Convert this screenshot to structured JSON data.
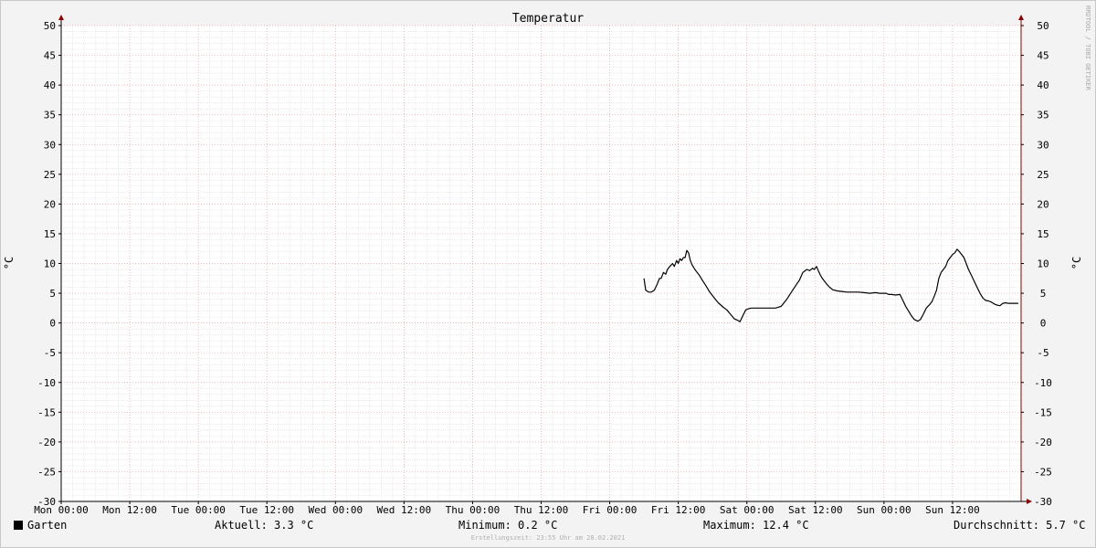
{
  "chart_data": {
    "type": "line",
    "title": "Temperatur",
    "ylabel": "°C",
    "ylim": [
      -30,
      50
    ],
    "y_ticks": [
      "50",
      "45",
      "40",
      "35",
      "30",
      "25",
      "20",
      "15",
      "10",
      "5",
      "0",
      "-5",
      "-10",
      "-15",
      "-20",
      "-25",
      "-30"
    ],
    "x_range_hours": [
      0,
      168
    ],
    "x_tick_labels": [
      "Mon 00:00",
      "Mon 12:00",
      "Tue 00:00",
      "Tue 12:00",
      "Wed 00:00",
      "Wed 12:00",
      "Thu 00:00",
      "Thu 12:00",
      "Fri 00:00",
      "Fri 12:00",
      "Sat 00:00",
      "Sat 12:00",
      "Sun 00:00",
      "Sun 12:00"
    ],
    "x_tick_hours": [
      0,
      12,
      24,
      36,
      48,
      60,
      72,
      84,
      96,
      108,
      120,
      132,
      144,
      156
    ],
    "grid": true,
    "watermark": "RRDTOOL / TOBI OETIKER",
    "series": [
      {
        "name": "Garten",
        "color": "#000000",
        "x": [
          102,
          102.3,
          102.8,
          103.3,
          103.8,
          104.3,
          104.7,
          105.0,
          105.4,
          105.8,
          106.1,
          106.5,
          107.0,
          107.3,
          107.7,
          108.0,
          108.3,
          108.6,
          108.9,
          109.2,
          109.5,
          109.8,
          110.1,
          110.4,
          110.6,
          110.9,
          111.3,
          111.7,
          112.2,
          112.8,
          113.5,
          114.3,
          115.0,
          115.8,
          116.5,
          117.2,
          117.8,
          118.3,
          118.8,
          119.3,
          119.8,
          120.3,
          120.8,
          121.5,
          122.2,
          123.0,
          124.0,
          125.0,
          126.0,
          127.0,
          127.8,
          128.5,
          129.2,
          129.8,
          130.5,
          131.0,
          131.5,
          131.8,
          132.2,
          132.5,
          132.9,
          133.2,
          133.6,
          134.0,
          134.5,
          135.0,
          135.8,
          136.6,
          137.5,
          138.5,
          139.5,
          140.5,
          141.5,
          142.5,
          143.2,
          144.0,
          144.4,
          144.8,
          145.3,
          146.0,
          146.8,
          147.3,
          147.8,
          148.3,
          148.8,
          149.3,
          149.9,
          150.4,
          150.9,
          151.4,
          151.9,
          152.4,
          152.8,
          153.2,
          153.6,
          154.0,
          154.4,
          154.8,
          155.2,
          155.6,
          156.0,
          156.4,
          156.8,
          157.2,
          157.6,
          158.0,
          158.4,
          158.8,
          159.3,
          159.8,
          160.3,
          160.8,
          161.3,
          161.8,
          162.3,
          162.8,
          163.3,
          163.8,
          164.3,
          164.8,
          165.3,
          165.7,
          166.1,
          166.5,
          167.0,
          167.5
        ],
        "values": [
          7.5,
          5.5,
          5.2,
          5.2,
          5.5,
          6.5,
          7.5,
          7.5,
          8.5,
          8.2,
          9.0,
          9.5,
          10.0,
          9.5,
          10.5,
          10.0,
          10.8,
          10.5,
          11.0,
          11.0,
          12.2,
          11.8,
          10.5,
          9.8,
          9.5,
          9.0,
          8.5,
          8.0,
          7.2,
          6.3,
          5.2,
          4.2,
          3.4,
          2.7,
          2.2,
          1.4,
          0.7,
          0.5,
          0.2,
          1.2,
          2.2,
          2.4,
          2.5,
          2.5,
          2.5,
          2.5,
          2.5,
          2.5,
          2.8,
          4.0,
          5.2,
          6.2,
          7.2,
          8.5,
          9.0,
          8.8,
          9.2,
          9.0,
          9.5,
          8.8,
          8.0,
          7.5,
          7.0,
          6.5,
          6.0,
          5.6,
          5.4,
          5.3,
          5.2,
          5.2,
          5.2,
          5.1,
          5.0,
          5.1,
          5.0,
          5.0,
          5.0,
          4.8,
          4.8,
          4.7,
          4.8,
          3.8,
          2.8,
          2.0,
          1.2,
          0.6,
          0.3,
          0.6,
          1.5,
          2.5,
          3.0,
          3.6,
          4.5,
          5.5,
          7.5,
          8.5,
          9.0,
          9.5,
          10.5,
          11.0,
          11.5,
          11.8,
          12.4,
          12.0,
          11.5,
          11.0,
          10.0,
          9.0,
          8.0,
          7.0,
          6.0,
          5.0,
          4.2,
          3.8,
          3.7,
          3.5,
          3.2,
          3.0,
          2.9,
          3.3,
          3.4,
          3.3,
          3.3,
          3.3,
          3.3,
          3.3
        ]
      }
    ]
  },
  "legend": {
    "series_label": "Garten",
    "aktuell": "Aktuell: 3.3 °C",
    "minimum": "Minimum: 0.2 °C",
    "maximum": "Maximum: 12.4 °C",
    "durchschnitt": "Durchschnitt: 5.7 °C"
  },
  "footer": "Erstellungszeit: 23:55 Uhr am 28.02.2021"
}
